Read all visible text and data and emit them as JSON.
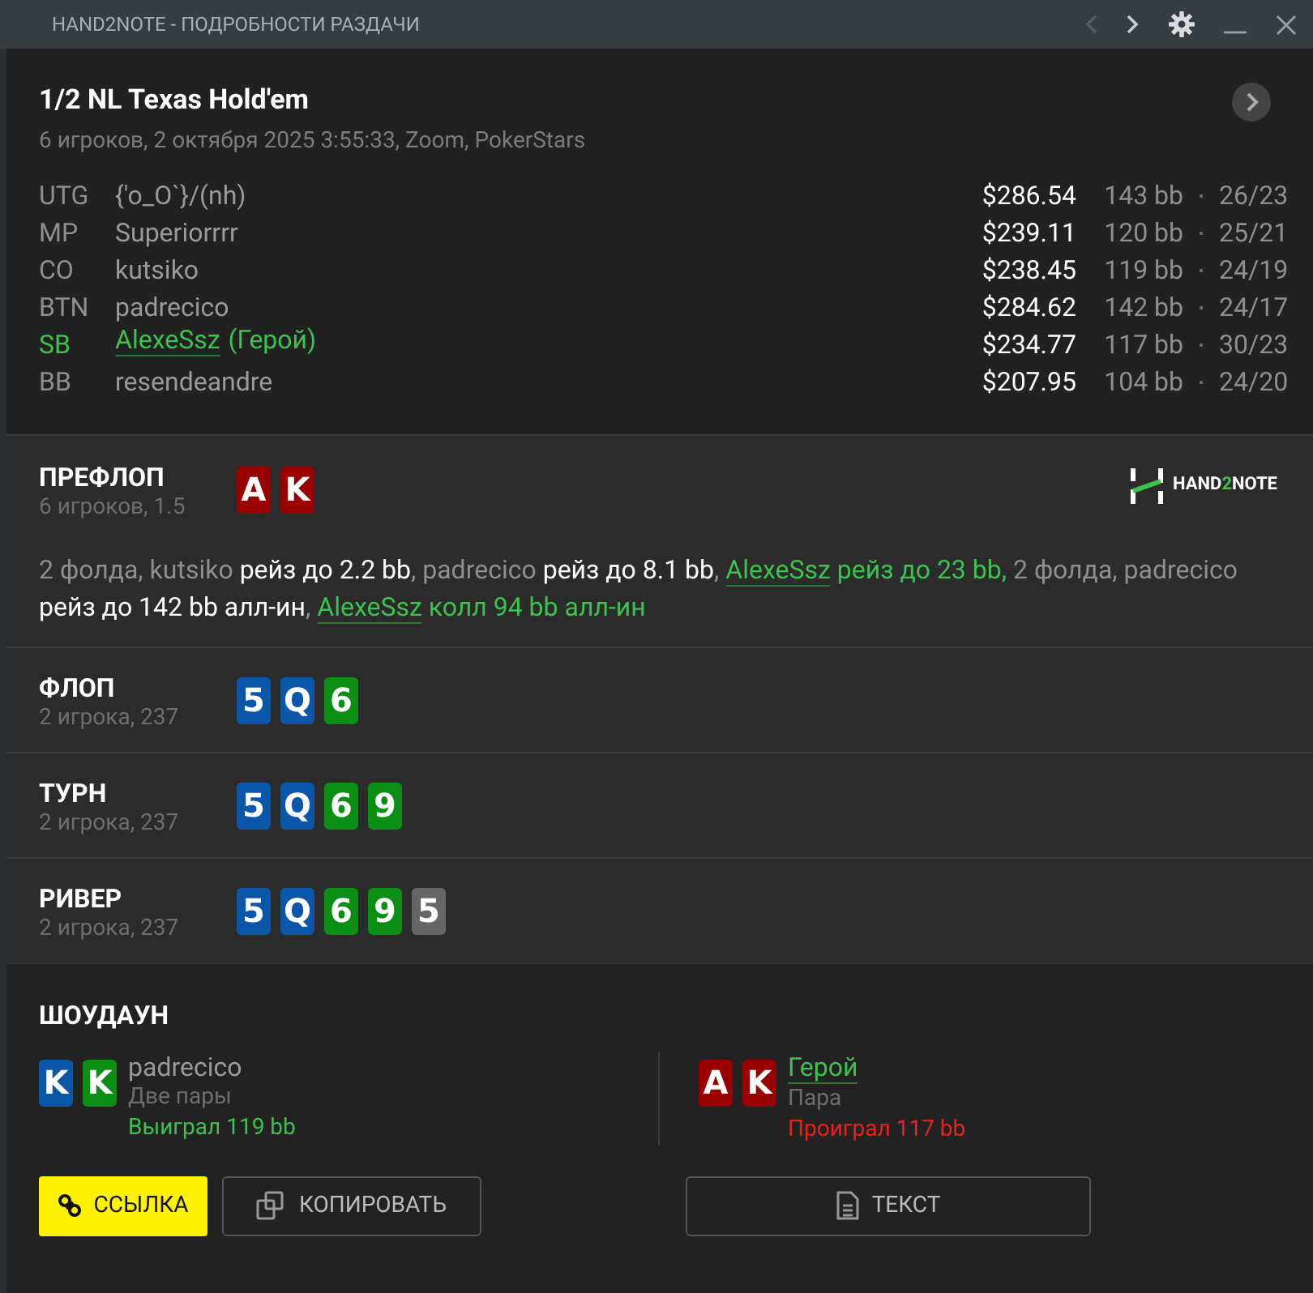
{
  "window": {
    "title": "HAND2NOTE - ПОДРОБНОСТИ РАЗДАЧИ"
  },
  "hand": {
    "title": "1/2 NL Texas Hold'em",
    "subtitle": "6 игроков, 2 октября 2025 3:55:33, Zoom, PokerStars"
  },
  "players": [
    {
      "position": "UTG",
      "name": "{'o_O`}/(nh)",
      "hero": false,
      "stack": "$286.54",
      "bb": "143 bb",
      "stats": "26/23"
    },
    {
      "position": "MP",
      "name": "Superiorrrr",
      "hero": false,
      "stack": "$239.11",
      "bb": "120 bb",
      "stats": "25/21"
    },
    {
      "position": "CO",
      "name": "kutsiko",
      "hero": false,
      "stack": "$238.45",
      "bb": "119 bb",
      "stats": "24/19"
    },
    {
      "position": "BTN",
      "name": "padrecico",
      "hero": false,
      "stack": "$284.62",
      "bb": "142 bb",
      "stats": "24/17"
    },
    {
      "position": "SB",
      "name": "AlexeSsz",
      "hero_tag": "(Герой)",
      "hero": true,
      "stack": "$234.77",
      "bb": "117 bb",
      "stats": "30/23"
    },
    {
      "position": "BB",
      "name": "resendeandre",
      "hero": false,
      "stack": "$207.95",
      "bb": "104 bb",
      "stats": "24/20"
    }
  ],
  "streets": [
    {
      "name": "ПРЕФЛОП",
      "info": "6 игроков, 1.5",
      "cards": [
        {
          "rank": "A",
          "color": "#990000"
        },
        {
          "rank": "K",
          "color": "#990000"
        }
      ],
      "actions": [
        {
          "kind": "plain",
          "text": "2 фолда, kutsiko "
        },
        {
          "kind": "action",
          "text": "рейз до 2.2 bb"
        },
        {
          "kind": "plain",
          "text": ", padrecico "
        },
        {
          "kind": "action",
          "text": "рейз до 8.1 bb"
        },
        {
          "kind": "plain",
          "text": ", "
        },
        {
          "kind": "hero",
          "text": "AlexeSsz"
        },
        {
          "kind": "hero_action",
          "text": " рейз до 23 bb,"
        },
        {
          "kind": "plain",
          "text": " 2 фолда, padrecico "
        },
        {
          "kind": "action",
          "text": "рейз до 142 bb алл-ин"
        },
        {
          "kind": "plain",
          "text": ", "
        },
        {
          "kind": "hero",
          "text": "AlexeSsz"
        },
        {
          "kind": "hero_action",
          "text": " колл 94 bb алл-ин"
        }
      ]
    },
    {
      "name": "ФЛОП",
      "info": "2 игрока, 237",
      "cards": [
        {
          "rank": "5",
          "color": "#0a56a8"
        },
        {
          "rank": "Q",
          "color": "#0a56a8"
        },
        {
          "rank": "6",
          "color": "#0a8f14"
        }
      ]
    },
    {
      "name": "ТУРН",
      "info": "2 игрока, 237",
      "cards": [
        {
          "rank": "5",
          "color": "#0a56a8"
        },
        {
          "rank": "Q",
          "color": "#0a56a8"
        },
        {
          "rank": "6",
          "color": "#0a8f14"
        },
        {
          "rank": "9",
          "color": "#0a8f14"
        }
      ]
    },
    {
      "name": "РИВЕР",
      "info": "2 игрока, 237",
      "cards": [
        {
          "rank": "5",
          "color": "#0a56a8"
        },
        {
          "rank": "Q",
          "color": "#0a56a8"
        },
        {
          "rank": "6",
          "color": "#0a8f14"
        },
        {
          "rank": "9",
          "color": "#0a8f14"
        },
        {
          "rank": "5",
          "color": "#666666"
        }
      ]
    }
  ],
  "logo": {
    "text_start": "HAND",
    "text_mid": "2",
    "text_end": "NOTE"
  },
  "showdown": {
    "title": "ШОУДАУН",
    "hands": [
      {
        "name": "padrecico",
        "hero": false,
        "combo": "Две пары",
        "result": "Выиграл 119 bb",
        "won": true,
        "cards": [
          {
            "rank": "K",
            "color": "#0a56a8"
          },
          {
            "rank": "K",
            "color": "#0a8f14"
          }
        ]
      },
      {
        "name": "Герой",
        "hero": true,
        "combo": "Пара",
        "result": "Проиграл 117 bb",
        "won": false,
        "cards": [
          {
            "rank": "A",
            "color": "#990000"
          },
          {
            "rank": "K",
            "color": "#990000"
          }
        ]
      }
    ]
  },
  "buttons": [
    {
      "kind": "link",
      "label": "ССЫЛКА"
    },
    {
      "kind": "copy",
      "label": "КОПИРОВАТЬ"
    },
    {
      "kind": "text",
      "label": "ТЕКСТ"
    }
  ]
}
